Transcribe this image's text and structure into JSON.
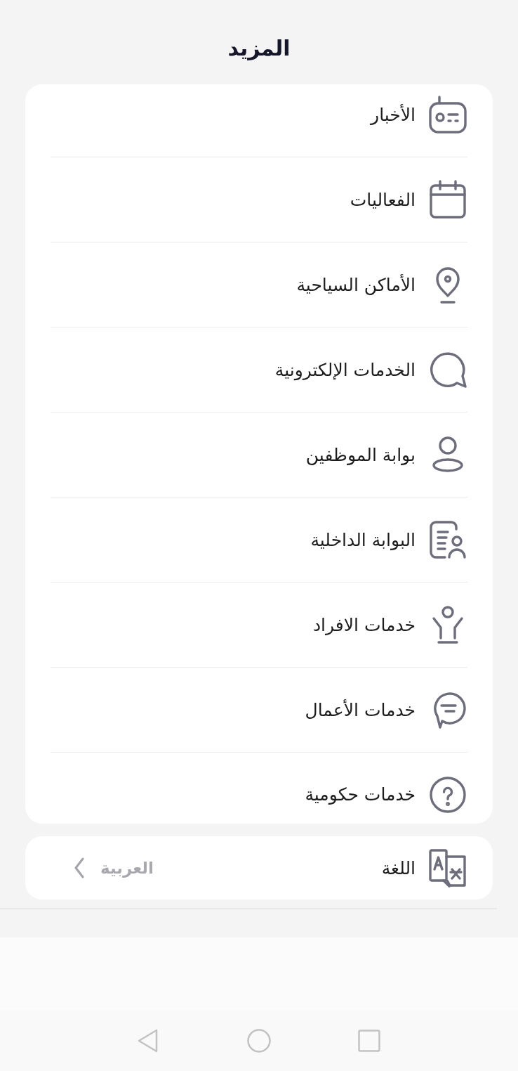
{
  "header": {
    "title": "المزيد"
  },
  "menu": [
    {
      "label": "الأخبار"
    },
    {
      "label": "الفعاليات"
    },
    {
      "label": "الأماكن السياحية"
    },
    {
      "label": "الخدمات الإلكترونية"
    },
    {
      "label": "بوابة الموظفين"
    },
    {
      "label": "البوابة الداخلية"
    },
    {
      "label": "خدمات الافراد"
    },
    {
      "label": "خدمات الأعمال"
    },
    {
      "label": "خدمات حكومية"
    }
  ],
  "language": {
    "label": "اللغة",
    "value": "العربية"
  }
}
